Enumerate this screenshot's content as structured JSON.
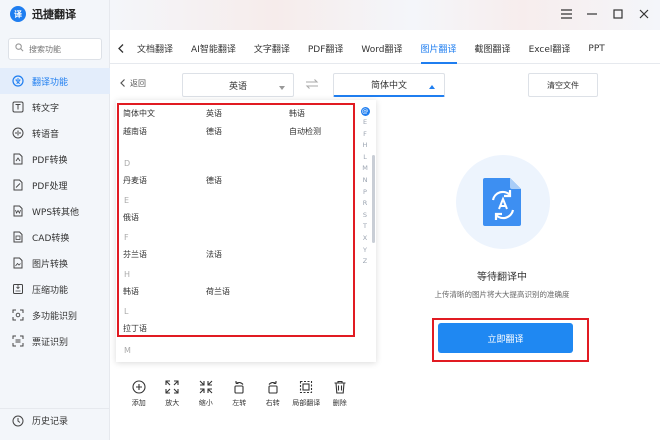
{
  "app": {
    "name": "迅捷翻译",
    "logo_text": "译"
  },
  "search": {
    "placeholder": "搜索功能"
  },
  "sidebar": {
    "items": [
      {
        "label": "翻译功能",
        "icon": "translate-icon"
      },
      {
        "label": "转文字",
        "icon": "text-icon"
      },
      {
        "label": "转语音",
        "icon": "speech-icon"
      },
      {
        "label": "PDF转换",
        "icon": "pdf-convert-icon"
      },
      {
        "label": "PDF处理",
        "icon": "pdf-process-icon"
      },
      {
        "label": "WPS转其他",
        "icon": "wps-icon"
      },
      {
        "label": "CAD转换",
        "icon": "cad-icon"
      },
      {
        "label": "图片转换",
        "icon": "image-icon"
      },
      {
        "label": "压缩功能",
        "icon": "compress-icon"
      },
      {
        "label": "多功能识别",
        "icon": "scan-icon"
      },
      {
        "label": "票证识别",
        "icon": "ticket-icon"
      }
    ],
    "history": "历史记录"
  },
  "tabs": [
    "文档翻译",
    "AI智能翻译",
    "文字翻译",
    "PDF翻译",
    "Word翻译",
    "图片翻译",
    "截图翻译",
    "Excel翻译",
    "PPT"
  ],
  "toolbar": {
    "back": "返回",
    "source_lang": "英语",
    "target_lang": "简体中文",
    "clear": "清空文件"
  },
  "languages": {
    "row1": [
      "简体中文",
      "英语",
      "韩语"
    ],
    "row2": [
      "越南语",
      "德语",
      "自动检测"
    ],
    "groups": [
      {
        "letter": "D",
        "items": [
          "丹麦语",
          "德语"
        ]
      },
      {
        "letter": "E",
        "items": [
          "俄语"
        ]
      },
      {
        "letter": "F",
        "items": [
          "芬兰语",
          "法语"
        ]
      },
      {
        "letter": "H",
        "items": [
          "韩语",
          "荷兰语"
        ]
      },
      {
        "letter": "L",
        "items": [
          "拉丁语"
        ]
      },
      {
        "letter": "M",
        "items": []
      }
    ],
    "alphabet": [
      "@",
      "E",
      "F",
      "H",
      "L",
      "M",
      "N",
      "P",
      "R",
      "S",
      "T",
      "X",
      "Y",
      "Z"
    ]
  },
  "panel": {
    "status": "等待翻译中",
    "hint": "上传清晰的图片将大大提高识别的准确度",
    "translate_button": "立即翻译"
  },
  "tools": [
    {
      "label": "添加",
      "icon": "add-icon"
    },
    {
      "label": "放大",
      "icon": "zoom-in-icon"
    },
    {
      "label": "缩小",
      "icon": "zoom-out-icon"
    },
    {
      "label": "左转",
      "icon": "rotate-left-icon"
    },
    {
      "label": "右转",
      "icon": "rotate-right-icon"
    },
    {
      "label": "局部翻译",
      "icon": "crop-icon"
    },
    {
      "label": "删除",
      "icon": "delete-icon"
    }
  ],
  "colors": {
    "accent": "#1f7ef0",
    "highlight": "#e11b22",
    "sidebar_bg": "#f3f6fa"
  }
}
